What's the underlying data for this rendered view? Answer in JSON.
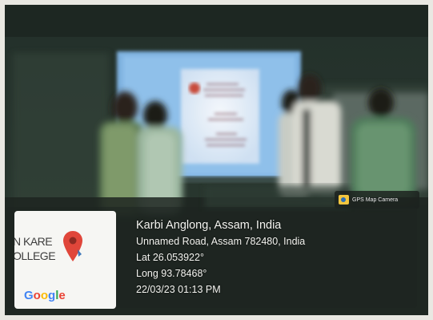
{
  "gps_badge": {
    "label": "GPS Map Camera",
    "icon": "camera-icon"
  },
  "map_thumbnail": {
    "place_text_line1": "N KARE",
    "place_text_line2": "OLLEGE",
    "pin_icon": "map-pin-icon",
    "logo_text": "Google",
    "logo_letters": [
      "G",
      "o",
      "o",
      "g",
      "l",
      "e"
    ]
  },
  "location": {
    "title": "Karbi Anglong, Assam, India",
    "address": "Unnamed Road, Assam 782480, India",
    "latitude": "Lat 26.053922°",
    "longitude": "Long 93.78468°",
    "datetime": "22/03/23 01:13 PM"
  },
  "colors": {
    "pin": "#E0463A",
    "pin_dot": "#2E6DB4",
    "overlay_text": "#F4F4F0"
  }
}
